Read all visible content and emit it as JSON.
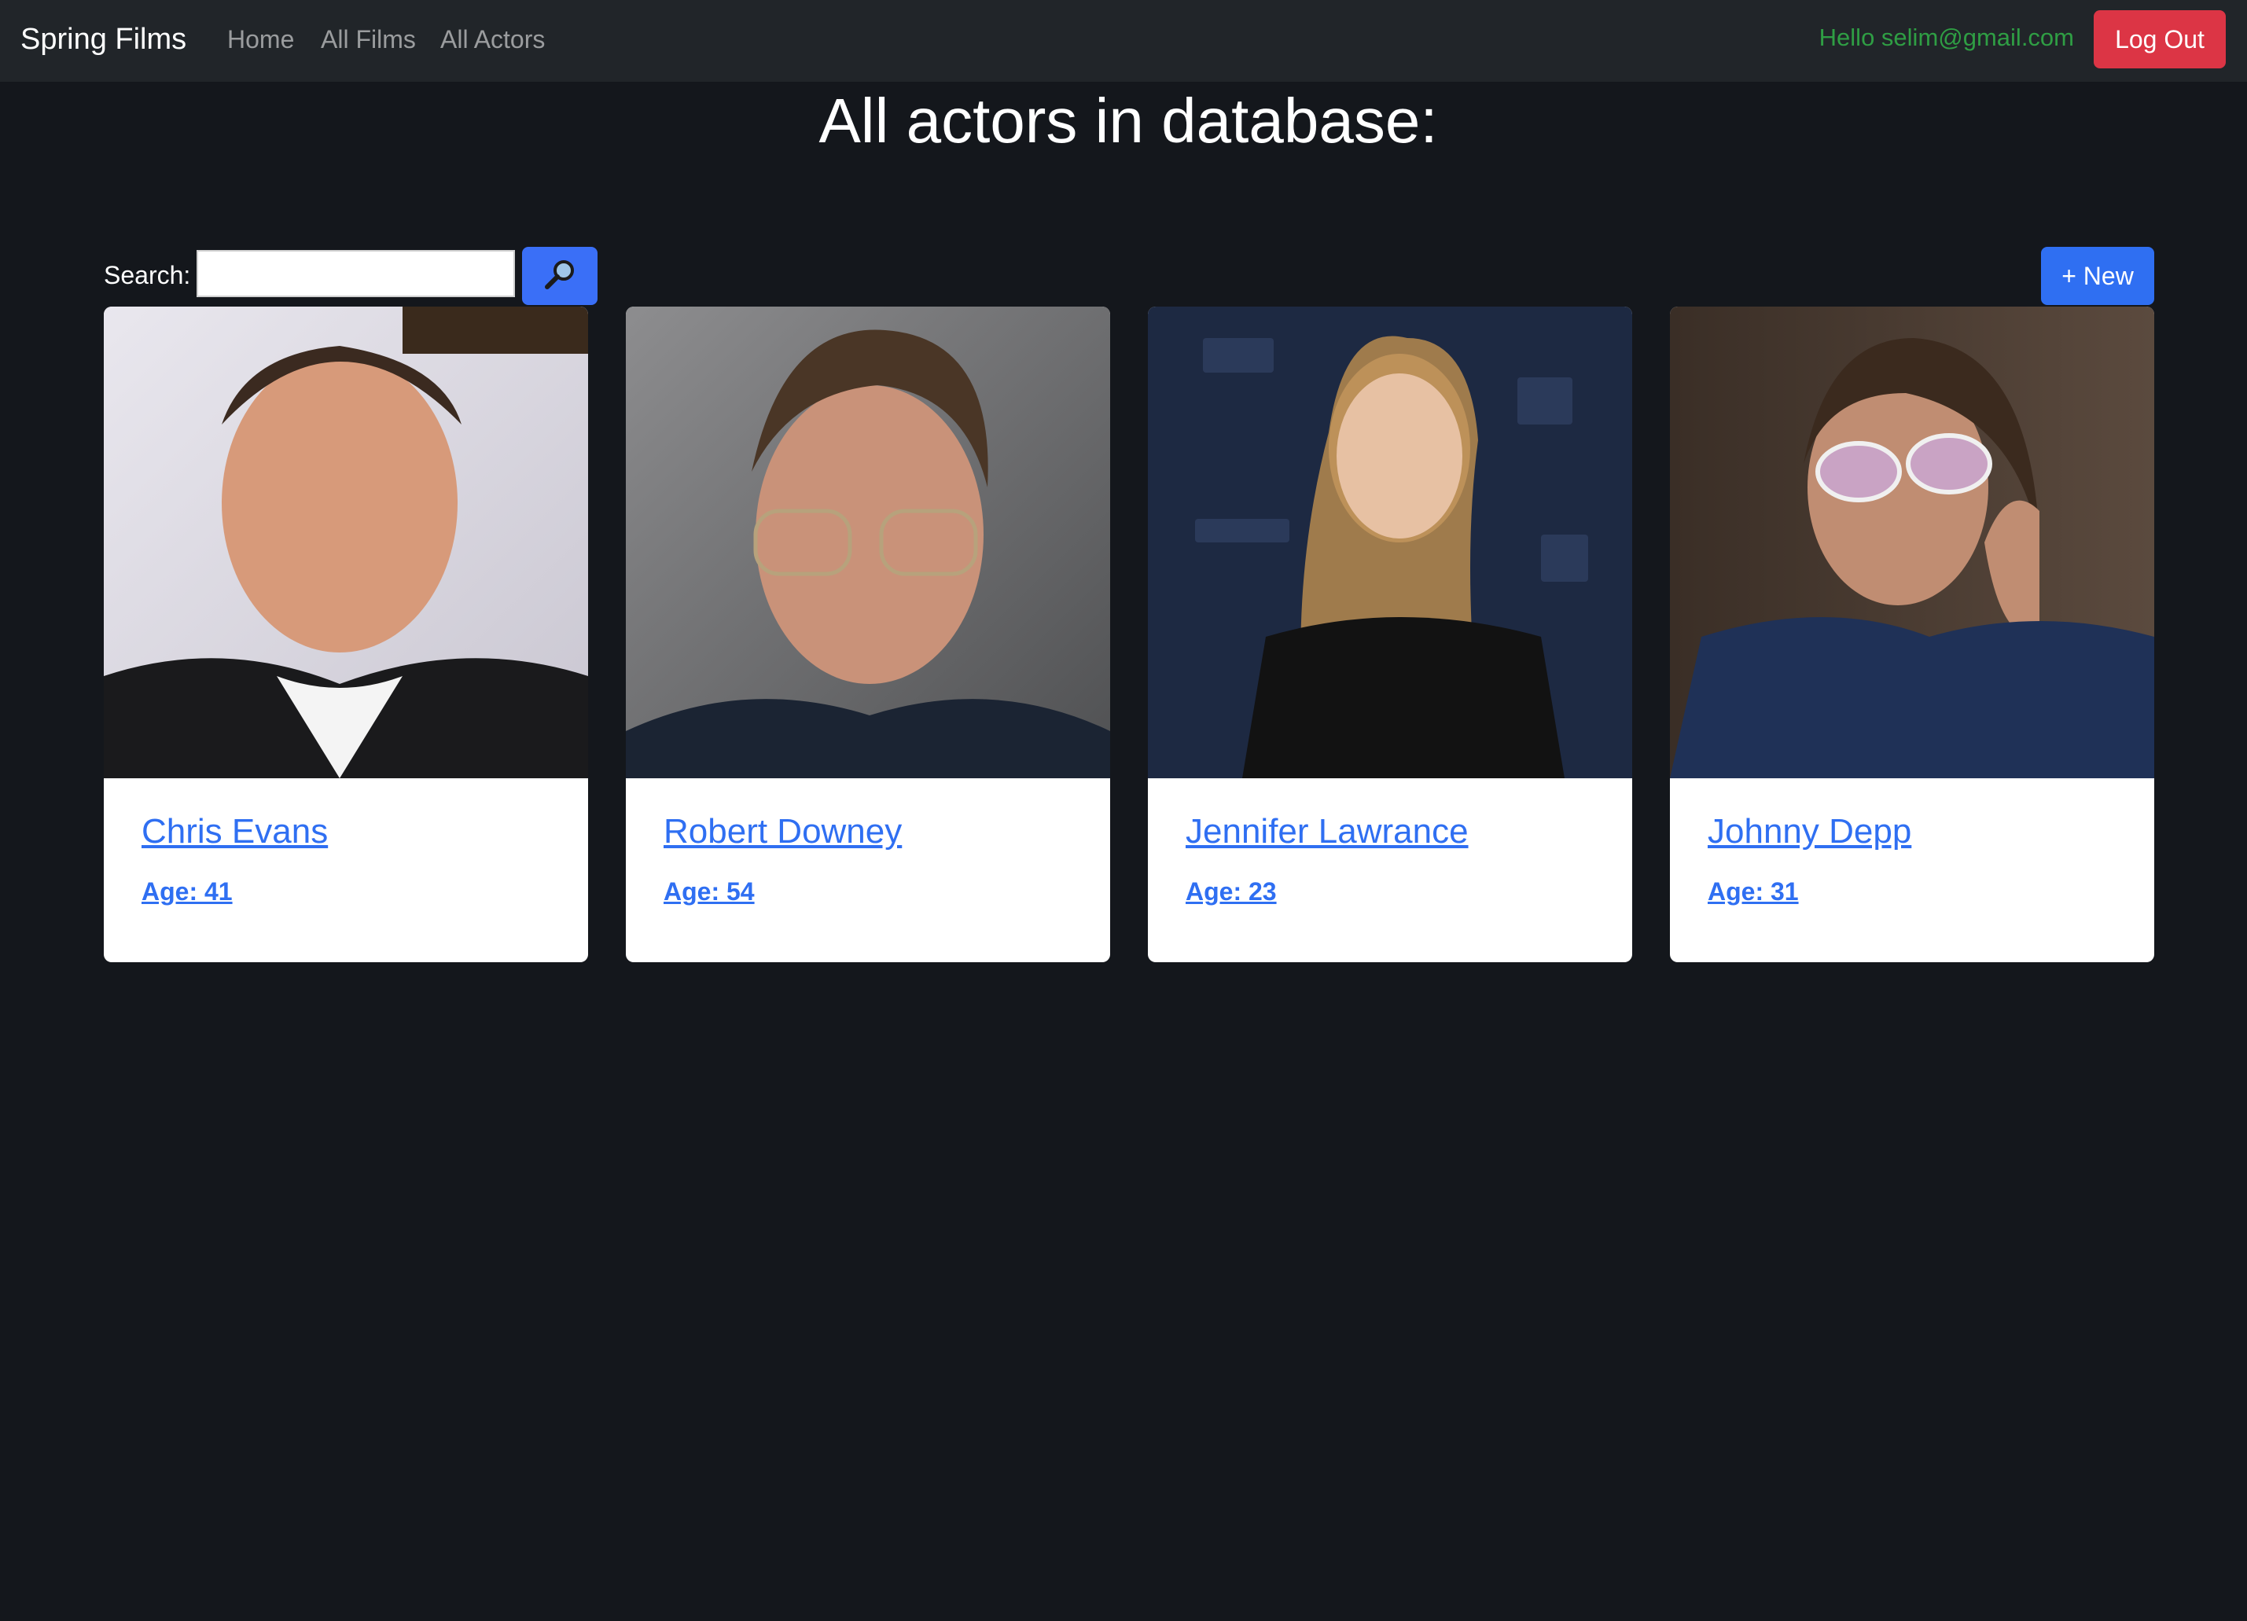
{
  "navbar": {
    "brand": "Spring Films",
    "links": [
      "Home",
      "All Films",
      "All Actors"
    ],
    "greeting": "Hello selim@gmail.com",
    "logout_label": "Log Out"
  },
  "main": {
    "title": "All actors in database:",
    "search": {
      "label": "Search:",
      "value": "",
      "placeholder": "",
      "button_icon": "magnifier-icon"
    },
    "new_button_label": "+ New"
  },
  "actors": [
    {
      "name": "Chris Evans",
      "age_label": "Age: 41",
      "photo": "actor-photo"
    },
    {
      "name": "Robert Downey",
      "age_label": "Age: 54",
      "photo": "actor-photo"
    },
    {
      "name": "Jennifer Lawrance",
      "age_label": "Age: 23",
      "photo": "actor-photo"
    },
    {
      "name": "Johnny Depp",
      "age_label": "Age: 31",
      "photo": "actor-photo"
    }
  ],
  "colors": {
    "navbar_bg": "#212529",
    "page_bg": "#14171c",
    "link": "#2f6ff2",
    "danger": "#dc3545",
    "greeting": "#2f9e44"
  }
}
